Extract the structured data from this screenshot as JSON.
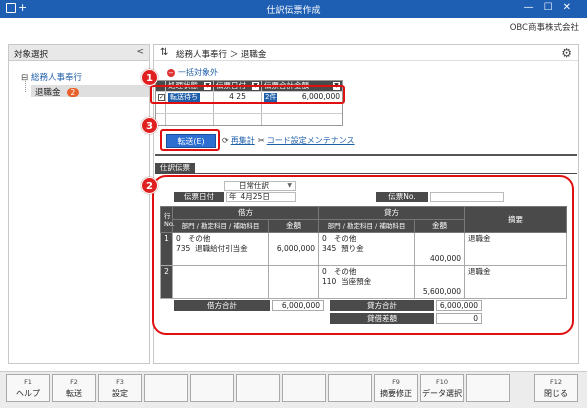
{
  "window": {
    "title": "仕訳伝票作成",
    "plus": "+",
    "company": "OBC商事株式会社",
    "controls": "—☐✕"
  },
  "left": {
    "header": "対象選択",
    "collapse": "<",
    "tree": {
      "root": "総務人事奉行",
      "child": "退職金",
      "child_count": "2"
    }
  },
  "right": {
    "breadcrumb": "総務人事奉行 ＞ 退職金",
    "exclude_all": "一括対象外",
    "grid": {
      "headers": [
        "処理状態",
        "伝票日付",
        "伝票合計金額"
      ],
      "row": {
        "checked": "✓",
        "status": "転送待ち",
        "date": "4 25",
        "amount_badge": "2件",
        "amount": "6,000,000"
      }
    },
    "transfer_button": "転送(E)",
    "recalc": "再集計",
    "code_settings": "コード設定メンテナンス",
    "tab": "仕訳伝票"
  },
  "voucher": {
    "kind": "日常仕訳",
    "date_label": "伝票日付",
    "date_prefix": "年",
    "date_value": "4月25日",
    "no_label": "伝票No.",
    "headers": {
      "row": "行\nNo.",
      "debit": "借方",
      "credit": "貸方",
      "summary": "摘要",
      "dept_account": "部門 / 勘定科目 / 補助科目",
      "amount": "金額"
    },
    "rows": [
      {
        "no": "1",
        "debit_dept": "0",
        "debit_dept_name": "その他",
        "debit_code": "735",
        "debit_name": "退職給付引当金",
        "debit_amount": "6,000,000",
        "credit_dept": "0",
        "credit_dept_name": "その他",
        "credit_code": "345",
        "credit_name": "預り金",
        "credit_amount": "400,000",
        "summary": "退職金"
      },
      {
        "no": "2",
        "credit_dept": "0",
        "credit_dept_name": "その他",
        "credit_code": "110",
        "credit_name": "当座預金",
        "credit_amount": "5,600,000",
        "summary": "退職金"
      }
    ],
    "debit_total_label": "借方合計",
    "debit_total": "6,000,000",
    "credit_total_label": "貸方合計",
    "credit_total": "6,000,000",
    "diff_label": "貸借差額",
    "diff": "0"
  },
  "markers": [
    "1",
    "3",
    "2"
  ],
  "fkeys": [
    {
      "key": "F1",
      "label": "ヘルプ"
    },
    {
      "key": "F2",
      "label": "転送"
    },
    {
      "key": "F3",
      "label": "設定"
    },
    {
      "key": "",
      "label": ""
    },
    {
      "key": "",
      "label": ""
    },
    {
      "key": "",
      "label": ""
    },
    {
      "key": "",
      "label": ""
    },
    {
      "key": "",
      "label": ""
    },
    {
      "key": "F9",
      "label": "摘要修正"
    },
    {
      "key": "F10",
      "label": "データ選択"
    },
    {
      "key": "",
      "label": ""
    },
    {
      "key": "F12",
      "label": "閉じる"
    }
  ]
}
